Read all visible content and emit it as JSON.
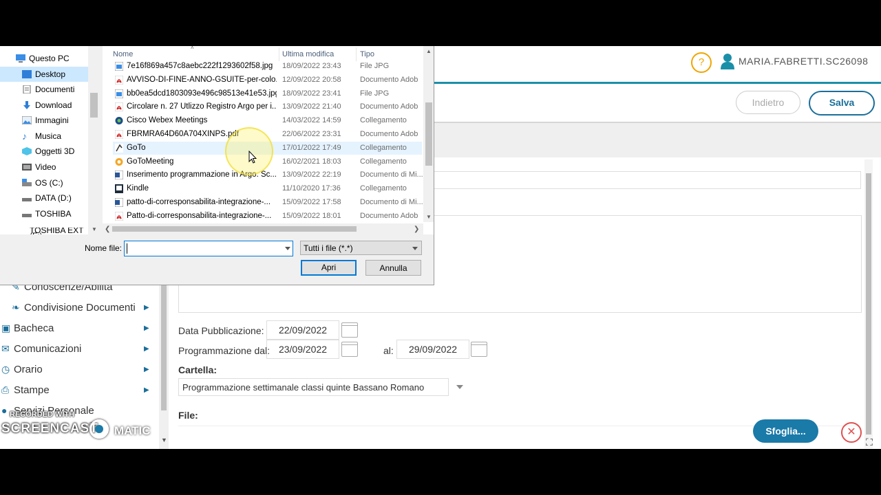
{
  "header": {
    "help_label": "?",
    "user_name": "MARIA.FABRETTI.SC26098",
    "back_label": "Indietro",
    "save_label": "Salva"
  },
  "sidebar": {
    "items": [
      {
        "label": "Conoscenze/Abilità",
        "icon": "pencil-icon"
      },
      {
        "label": "Condivisione Documenti",
        "icon": "share-icon"
      },
      {
        "label": "Bacheca",
        "icon": "board-icon"
      },
      {
        "label": "Comunicazioni",
        "icon": "message-icon"
      },
      {
        "label": "Orario",
        "icon": "clock-icon"
      },
      {
        "label": "Stampe",
        "icon": "print-icon"
      },
      {
        "label": "Servizi Personale",
        "icon": "user-icon"
      }
    ]
  },
  "form": {
    "publication_label": "Data Pubblicazione:",
    "publication_date": "22/09/2022",
    "schedule_from_label": "Programmazione dal:",
    "schedule_from": "23/09/2022",
    "schedule_to_label": "al:",
    "schedule_to": "29/09/2022",
    "folder_label": "Cartella:",
    "folder_value": "Programmazione settimanale classi quinte Bassano Romano",
    "file_label": "File:",
    "browse_label": "Sfoglia..."
  },
  "watermark": {
    "recorded": "RECORDED WITH",
    "brand_left": "SCREENCAST",
    "brand_right": "MATIC"
  },
  "dialog": {
    "nav_items": [
      {
        "label": "Questo PC",
        "icon": "pc-icon"
      },
      {
        "label": "Desktop",
        "icon": "desktop-icon",
        "selected": true
      },
      {
        "label": "Documenti",
        "icon": "documents-icon"
      },
      {
        "label": "Download",
        "icon": "download-icon"
      },
      {
        "label": "Immagini",
        "icon": "images-icon"
      },
      {
        "label": "Musica",
        "icon": "music-icon"
      },
      {
        "label": "Oggetti 3D",
        "icon": "3d-objects-icon"
      },
      {
        "label": "Video",
        "icon": "video-icon"
      },
      {
        "label": "OS (C:)",
        "icon": "drive-icon"
      },
      {
        "label": "DATA (D:)",
        "icon": "drive-icon"
      },
      {
        "label": "TOSHIBA EXT (F",
        "icon": "drive-icon"
      },
      {
        "label": "TOSHIBA EXT (F:)",
        "icon": "drive-icon"
      }
    ],
    "columns": {
      "name": "Nome",
      "modified": "Ultima modifica",
      "type": "Tipo"
    },
    "files": [
      {
        "name": "7e16f869a457c8aebc222f1293602f58.jpg",
        "modified": "18/09/2022 23:43",
        "type": "File JPG",
        "icon": "image-file-icon"
      },
      {
        "name": "AVVISO-DI-FINE-ANNO-GSUITE-per-colo...",
        "modified": "12/09/2022 20:58",
        "type": "Documento Adob",
        "icon": "pdf-icon"
      },
      {
        "name": "bb0ea5dcd1803093e496c98513e41e53.jpg",
        "modified": "18/09/2022 23:41",
        "type": "File JPG",
        "icon": "image-file-icon"
      },
      {
        "name": "Circolare n. 27 Utlizzo Registro Argo per i...",
        "modified": "13/09/2022 21:40",
        "type": "Documento Adob",
        "icon": "pdf-icon"
      },
      {
        "name": "Cisco Webex Meetings",
        "modified": "14/03/2022 14:59",
        "type": "Collegamento",
        "icon": "webex-icon"
      },
      {
        "name": "FBRMRA64D60A704XINPS.pdf",
        "modified": "22/06/2022 23:31",
        "type": "Documento Adob",
        "icon": "pdf-icon"
      },
      {
        "name": "GoTo",
        "modified": "17/01/2022 17:49",
        "type": "Collegamento",
        "icon": "goto-icon",
        "hover": true
      },
      {
        "name": "GoToMeeting",
        "modified": "16/02/2021 18:03",
        "type": "Collegamento",
        "icon": "gotomeeting-icon"
      },
      {
        "name": "Inserimento programmazione in Argo. Sc...",
        "modified": "13/09/2022 22:19",
        "type": "Documento di Mi...",
        "icon": "word-icon"
      },
      {
        "name": "Kindle",
        "modified": "11/10/2020 17:36",
        "type": "Collegamento",
        "icon": "kindle-icon"
      },
      {
        "name": "patto-di-corresponsabilita-integrazione-...",
        "modified": "15/09/2022 17:58",
        "type": "Documento di Mi...",
        "icon": "word-icon"
      },
      {
        "name": "Patto-di-corresponsabilita-integrazione-...",
        "modified": "15/09/2022 18:01",
        "type": "Documento Adob",
        "icon": "pdf-icon"
      }
    ],
    "filename_label": "Nome file:",
    "filename_value": "",
    "filter_value": "Tutti i file (*.*)",
    "open_label": "Apri",
    "cancel_label": "Annulla"
  },
  "colors": {
    "accent": "#1a7aa8",
    "warning": "#f0a500",
    "danger": "#e05050"
  }
}
